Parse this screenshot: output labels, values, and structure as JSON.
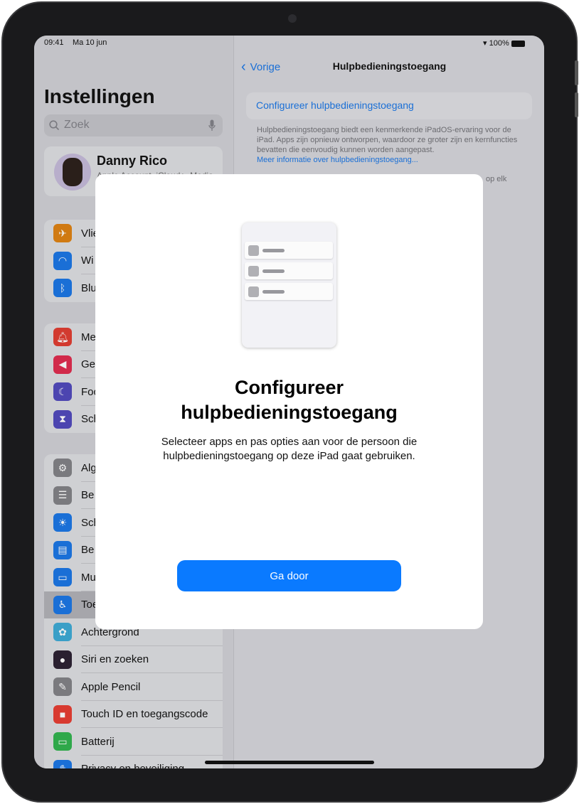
{
  "status_bar": {
    "time": "09:41",
    "date": "Ma 10 jun",
    "battery": "100%"
  },
  "sidebar": {
    "title": "Instellingen",
    "search_placeholder": "Zoek",
    "profile": {
      "name": "Danny Rico",
      "subtitle": "Apple Account, iCloud+, Media"
    },
    "groups": [
      [
        {
          "label": "Vlie",
          "icon": "airplane-icon",
          "color": "#d07a12"
        },
        {
          "label": "Wi",
          "icon": "wifi-icon",
          "color": "#1a6fd6"
        },
        {
          "label": "Blu",
          "icon": "bluetooth-icon",
          "color": "#1a6fd6"
        }
      ],
      [
        {
          "label": "Me",
          "icon": "notifications-icon",
          "color": "#d23a2f"
        },
        {
          "label": "Ge",
          "icon": "sound-icon",
          "color": "#d12a4a"
        },
        {
          "label": "Foc",
          "icon": "focus-moon-icon",
          "color": "#4c45b0"
        },
        {
          "label": "Sch",
          "icon": "hourglass-icon",
          "color": "#4c45b0"
        }
      ],
      [
        {
          "label": "Alg",
          "icon": "gear-icon",
          "color": "#7a7a7e"
        },
        {
          "label": "Be",
          "icon": "control-center-icon",
          "color": "#7a7a7e"
        },
        {
          "label": "Sch",
          "icon": "brightness-icon",
          "color": "#1a6fd6"
        },
        {
          "label": "Be",
          "icon": "home-screen-icon",
          "color": "#1a6fd6"
        },
        {
          "label": "Mu",
          "icon": "multitasking-icon",
          "color": "#1a6fd6"
        },
        {
          "label": "Toe",
          "icon": "accessibility-icon",
          "color": "#1a6fd6",
          "selected": true
        },
        {
          "label": "Achtergrond",
          "icon": "wallpaper-icon",
          "color": "#3a9fc7"
        },
        {
          "label": "Siri en zoeken",
          "icon": "siri-icon",
          "color": "#2a2030"
        },
        {
          "label": "Apple Pencil",
          "icon": "pencil-icon",
          "color": "#7a7a7e"
        },
        {
          "label": "Touch ID en toegangscode",
          "icon": "lock-icon",
          "color": "#d83a30"
        },
        {
          "label": "Batterij",
          "icon": "battery-icon",
          "color": "#2fa84a"
        },
        {
          "label": "Privacy en beveiliging",
          "icon": "privacy-hand-icon",
          "color": "#1a6fd6"
        }
      ]
    ]
  },
  "detail": {
    "back_label": "Vorige",
    "nav_title": "Hulpbedieningstoegang",
    "configure_link": "Configureer hulpbedieningstoegang",
    "description": "Hulpbedieningstoegang biedt een kenmerkende iPadOS-ervaring voor de iPad. Apps zijn opnieuw ontworpen, waardoor ze groter zijn en kernfuncties bevatten die eenvoudig kunnen worden aangepast.",
    "more_link": "Meer informatie over hulpbedieningstoegang...",
    "partial_text": "op elk"
  },
  "modal": {
    "title": "Configureer hulpbedieningstoegang",
    "description": "Selecteer apps en pas opties aan voor de persoon die hulpbedieningstoegang op deze iPad gaat gebruiken.",
    "continue_label": "Ga door"
  },
  "colors": {
    "accent": "#0a7aff"
  }
}
